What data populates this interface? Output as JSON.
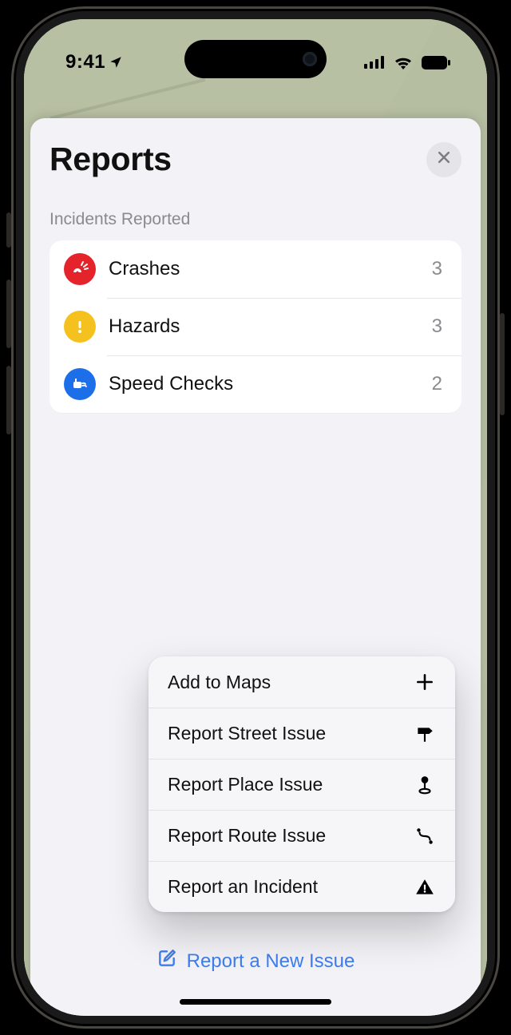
{
  "statusbar": {
    "time": "9:41"
  },
  "sheet": {
    "title": "Reports",
    "section_label": "Incidents Reported",
    "incidents": [
      {
        "label": "Crashes",
        "count": "3"
      },
      {
        "label": "Hazards",
        "count": "3"
      },
      {
        "label": "Speed Checks",
        "count": "2"
      }
    ]
  },
  "menu": {
    "items": [
      {
        "label": "Add to Maps"
      },
      {
        "label": "Report Street Issue"
      },
      {
        "label": "Report Place Issue"
      },
      {
        "label": "Report Route Issue"
      },
      {
        "label": "Report an Incident"
      }
    ]
  },
  "footer": {
    "new_issue_label": "Report a New Issue"
  },
  "colors": {
    "accent_blue": "#3c7df0",
    "crash_red": "#e4232b",
    "hazard_yellow": "#f5c11e",
    "speed_blue": "#1c6fe8"
  }
}
